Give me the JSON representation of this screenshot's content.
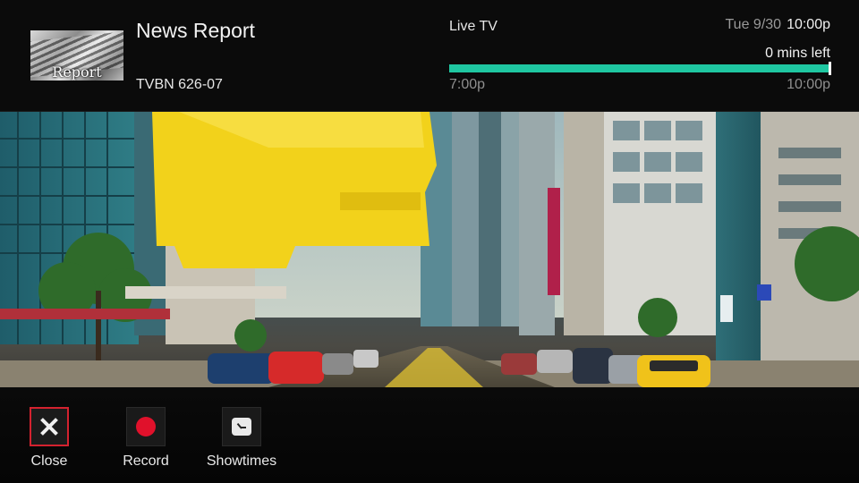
{
  "program": {
    "thumbnail_label": "Report",
    "title": "News Report",
    "channel": "TVBN 626-07"
  },
  "status": {
    "source": "Live TV",
    "date": "Tue 9/30",
    "time": "10:00p",
    "remaining": "0 mins left",
    "start_time": "7:00p",
    "end_time": "10:00p",
    "progress_fraction": 1.0,
    "progress_color": "#1fc7a1"
  },
  "actions": [
    {
      "label": "Close",
      "icon": "close-icon",
      "focused": true
    },
    {
      "label": "Record",
      "icon": "record-icon",
      "focused": false
    },
    {
      "label": "Showtimes",
      "icon": "clock-icon",
      "focused": false
    }
  ],
  "colors": {
    "focus_border": "#d4222f",
    "record_dot": "#e0112b"
  }
}
